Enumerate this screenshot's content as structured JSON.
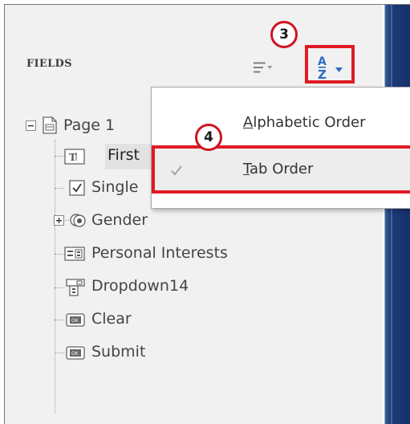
{
  "panel": {
    "title": "FIELDS"
  },
  "annotations": {
    "callout_sort": "3",
    "callout_tab": "4"
  },
  "sort_menu": {
    "alphabetic": {
      "mnemonic": "A",
      "rest": "lphabetic Order"
    },
    "tab": {
      "mnemonic": "T",
      "rest": "ab Order",
      "checked": true
    }
  },
  "tree": {
    "page": "Page 1",
    "items": [
      {
        "label": "First",
        "icon": "text-field-icon"
      },
      {
        "label": "Single",
        "icon": "checkbox-icon"
      },
      {
        "label": "Gender",
        "icon": "radio-group-icon",
        "expandable": true
      },
      {
        "label": "Personal Interests",
        "icon": "list-box-icon"
      },
      {
        "label": "Dropdown14",
        "icon": "dropdown-icon"
      },
      {
        "label": "Clear",
        "icon": "button-icon"
      },
      {
        "label": "Submit",
        "icon": "button-icon"
      }
    ]
  },
  "colors": {
    "highlight_red": "#e01b24",
    "accent_blue": "#2b6cc4",
    "panel_bg": "#f1f1f1"
  }
}
